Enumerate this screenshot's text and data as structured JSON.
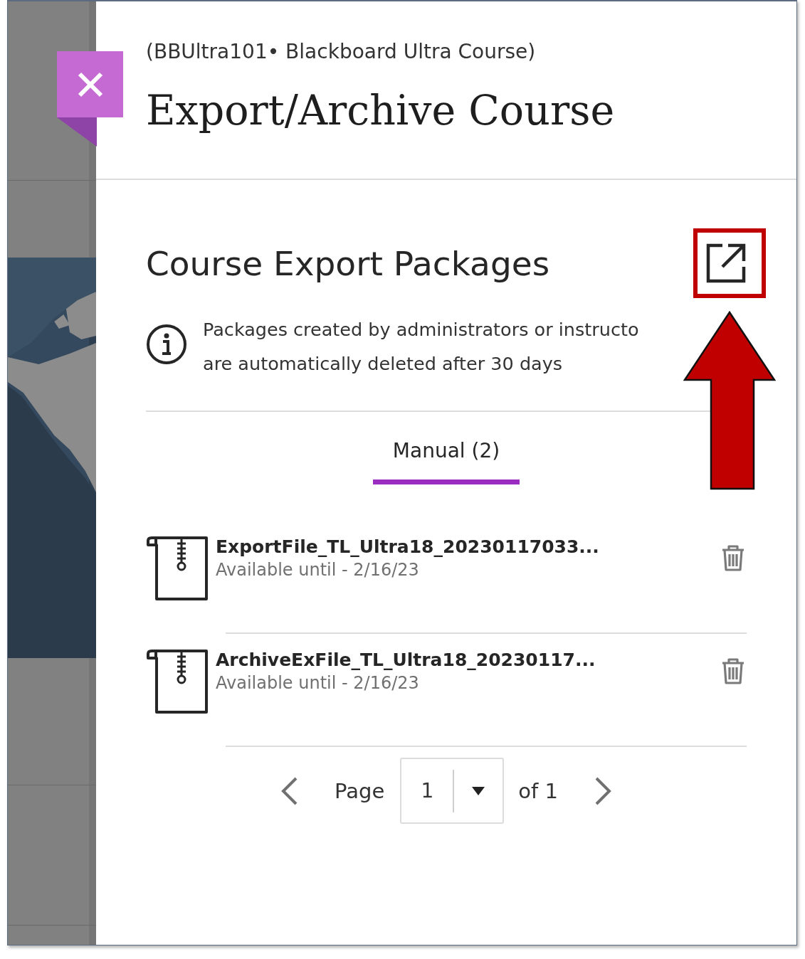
{
  "course_label": "(BBUltra101• Blackboard Ultra Course)",
  "title": "Export/Archive Course",
  "section": {
    "heading": "Course Export Packages",
    "info_lines": [
      "Packages created by administrators or instructo",
      "are automatically deleted after 30 days"
    ]
  },
  "tabs": [
    {
      "label": "Manual (2)",
      "selected": true
    }
  ],
  "packages": [
    {
      "name": "ExportFile_TL_Ultra18_20230117033...",
      "availability": "Available until - 2/16/23"
    },
    {
      "name": "ArchiveExFile_TL_Ultra18_20230117...",
      "availability": "Available until - 2/16/23"
    }
  ],
  "pagination": {
    "label": "Page",
    "page": "1",
    "total": "of 1"
  }
}
